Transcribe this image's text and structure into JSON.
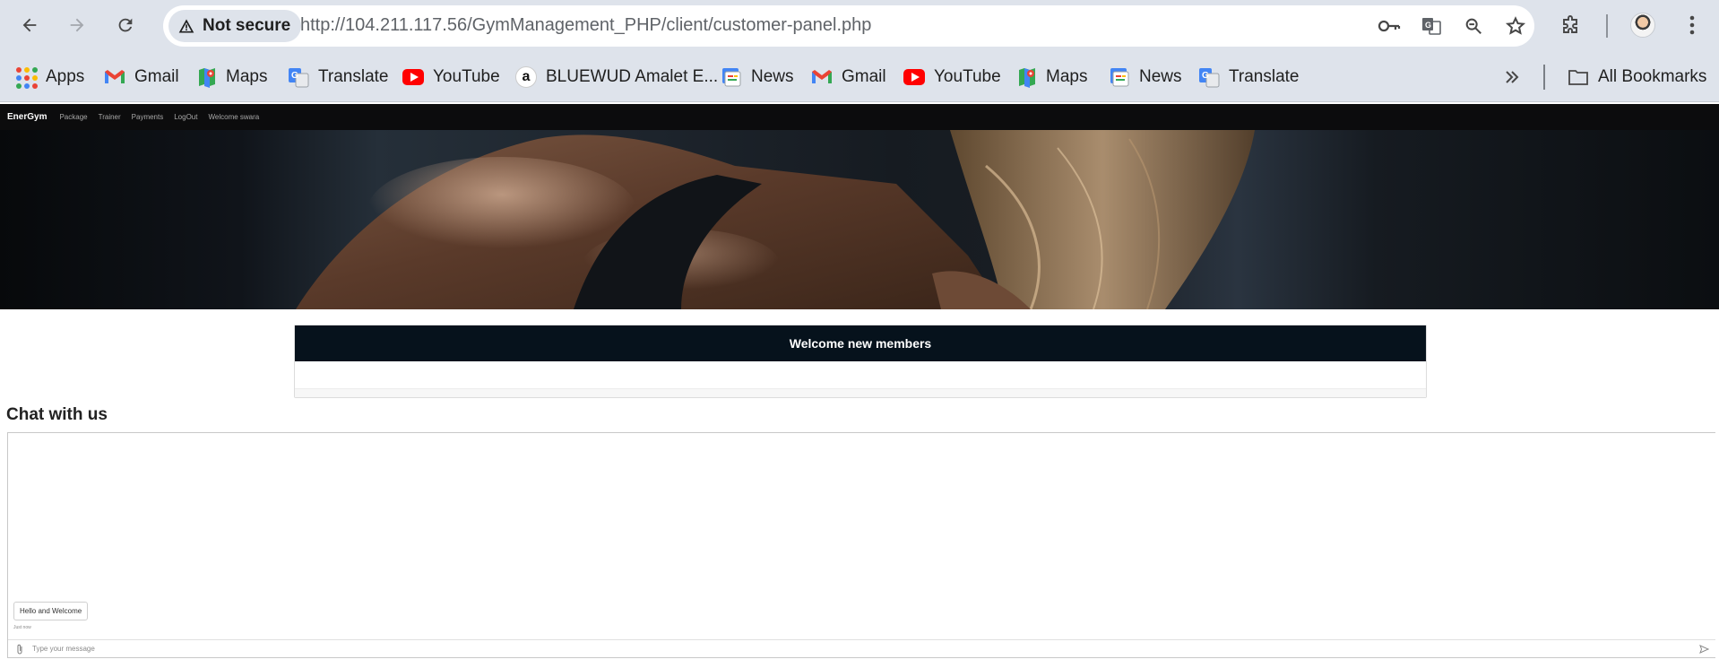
{
  "browser": {
    "security_label": "Not secure",
    "url_host": "http://104.211.117.56",
    "url_path": "/GymManagement_PHP/client/customer-panel.php"
  },
  "bookmarks": {
    "items": [
      {
        "label": "Apps",
        "icon": "apps-grid-icon"
      },
      {
        "label": "Gmail",
        "icon": "gmail-icon"
      },
      {
        "label": "Maps",
        "icon": "maps-icon"
      },
      {
        "label": "Translate",
        "icon": "translate-icon"
      },
      {
        "label": "YouTube",
        "icon": "youtube-icon"
      },
      {
        "label": "BLUEWUD Amalet E...",
        "icon": "amazon-icon"
      },
      {
        "label": "News",
        "icon": "news-icon"
      },
      {
        "label": "Gmail",
        "icon": "gmail-icon"
      },
      {
        "label": "YouTube",
        "icon": "youtube-icon"
      },
      {
        "label": "Maps",
        "icon": "maps-icon"
      },
      {
        "label": "News",
        "icon": "news-icon"
      },
      {
        "label": "Translate",
        "icon": "translate-icon"
      }
    ],
    "all_bookmarks_label": "All Bookmarks"
  },
  "site": {
    "brand": "EnerGym",
    "nav": [
      "Package",
      "Trainer",
      "Payments",
      "LogOut",
      "Welcome swara"
    ]
  },
  "welcome_card": {
    "title": "Welcome new members"
  },
  "chat": {
    "title": "Chat with us",
    "message": "Hello and Welcome",
    "message_time": "Just now",
    "input_placeholder": "Type your message"
  },
  "colors": {
    "chrome_bg": "#dee3eb",
    "site_nav_bg": "#0c0c0d",
    "welcome_header_bg": "#06121c"
  }
}
